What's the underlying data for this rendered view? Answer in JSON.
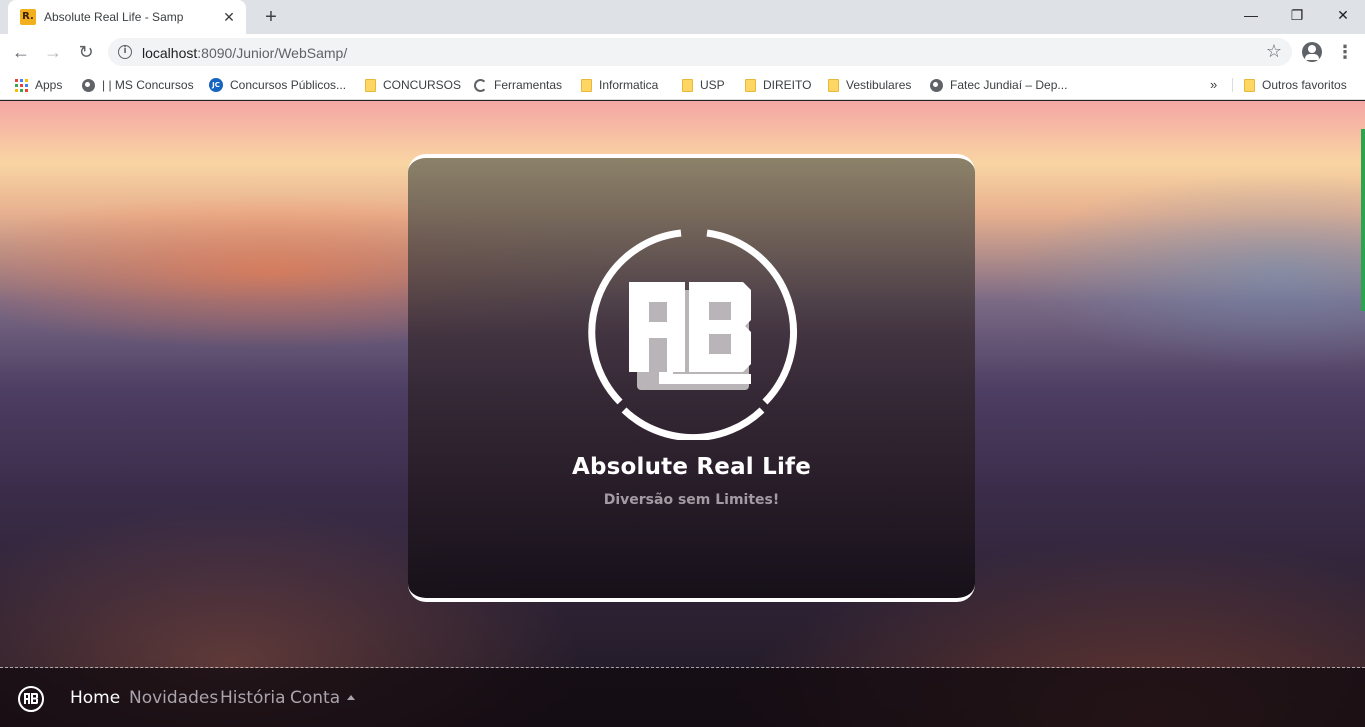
{
  "browser": {
    "tab": {
      "favicon_text": "R.",
      "title": "Absolute Real Life - Samp"
    },
    "url": {
      "host": "localhost",
      "path": ":8090/Junior/WebSamp/"
    },
    "bookmarks": [
      {
        "label": "Apps",
        "icon": "apps-grid-icon"
      },
      {
        "label": "| | MS Concursos",
        "icon": "globe-icon"
      },
      {
        "label": "Concursos Públicos...",
        "icon": "jc-icon"
      },
      {
        "label": "CONCURSOS",
        "icon": "folder-icon"
      },
      {
        "label": "Ferramentas",
        "icon": "tool-icon"
      },
      {
        "label": "Informatica",
        "icon": "folder-icon"
      },
      {
        "label": "USP",
        "icon": "folder-icon"
      },
      {
        "label": "DIREITO",
        "icon": "folder-icon"
      },
      {
        "label": "Vestibulares",
        "icon": "folder-icon"
      },
      {
        "label": "Fatec Jundiaí – Dep...",
        "icon": "globe-icon"
      }
    ],
    "more_label": "»",
    "other_favorites": "Outros favoritos"
  },
  "hero": {
    "title": "Absolute Real Life",
    "subtitle": "Diversão sem Limites!",
    "logo_text": "AB"
  },
  "nav": {
    "items": [
      "Home",
      "Novidades",
      "História",
      "Conta"
    ],
    "active": "Home"
  },
  "colors": {
    "accent_green": "#2ea44f",
    "white": "#ffffff",
    "muted_text": "#a9a3ab"
  }
}
